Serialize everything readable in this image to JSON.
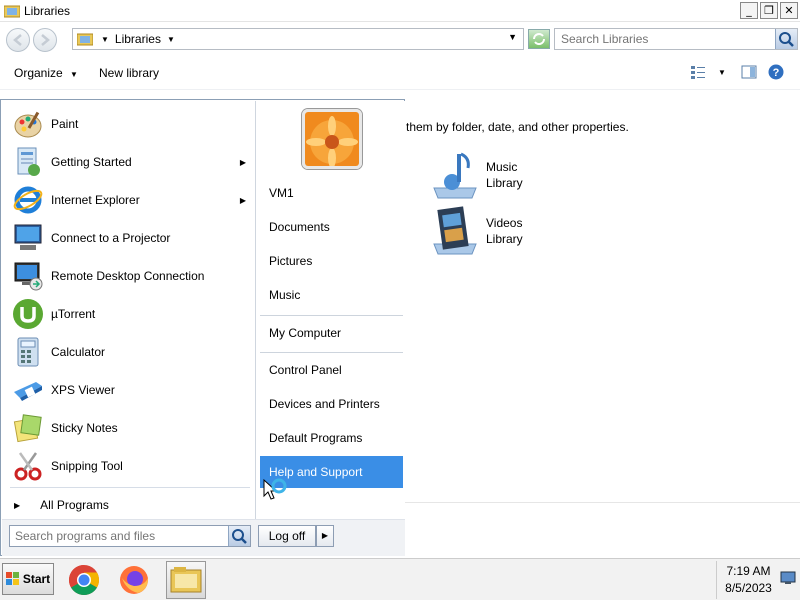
{
  "window": {
    "title": "Libraries",
    "minimize_glyph": "_",
    "maximize_glyph": "❐",
    "close_glyph": "✕"
  },
  "address_bar": {
    "crumb_label": "Libraries",
    "crumb_arrow": "▼",
    "dropdown_arrow": "▼",
    "search_placeholder": "Search Libraries"
  },
  "command_bar": {
    "organize_label": "Organize",
    "organize_arrow": "▼",
    "new_library_label": "New library",
    "view_arrow": "▼"
  },
  "content": {
    "description": "them by folder, date, and other properties.",
    "libraries": [
      {
        "name": "Music",
        "sub": "Library",
        "icon": "music-note-icon"
      },
      {
        "name": "Videos",
        "sub": "Library",
        "icon": "film-icon"
      }
    ]
  },
  "start_menu": {
    "programs": [
      {
        "label": "Paint",
        "icon": "paint-palette-icon",
        "has_submenu": false
      },
      {
        "label": "Getting Started",
        "icon": "getting-started-icon",
        "has_submenu": true
      },
      {
        "label": "Internet Explorer",
        "icon": "internet-explorer-icon",
        "has_submenu": true
      },
      {
        "label": "Connect to a Projector",
        "icon": "projector-icon",
        "has_submenu": false
      },
      {
        "label": "Remote Desktop Connection",
        "icon": "remote-desktop-icon",
        "has_submenu": false
      },
      {
        "label": "µTorrent",
        "icon": "utorrent-icon",
        "has_submenu": false
      },
      {
        "label": "Calculator",
        "icon": "calculator-icon",
        "has_submenu": false
      },
      {
        "label": "XPS Viewer",
        "icon": "xps-viewer-icon",
        "has_submenu": false
      },
      {
        "label": "Sticky Notes",
        "icon": "sticky-notes-icon",
        "has_submenu": false
      },
      {
        "label": "Snipping Tool",
        "icon": "scissors-icon",
        "has_submenu": false
      }
    ],
    "submenu_arrow": "▶",
    "all_programs_arrow": "▶",
    "all_programs_label": "All Programs",
    "right_items": {
      "user": "VM1",
      "documents": "Documents",
      "pictures": "Pictures",
      "music": "Music",
      "my_computer": "My Computer",
      "control_panel": "Control Panel",
      "devices_printers": "Devices and Printers",
      "default_programs": "Default Programs",
      "help_support": "Help and Support"
    },
    "search_placeholder": "Search programs and files",
    "log_off_label": "Log off",
    "log_off_arrow": "▶"
  },
  "taskbar": {
    "start_label": "Start",
    "time": "7:19 AM",
    "date": "8/5/2023",
    "pinned": [
      "chrome-icon",
      "firefox-icon",
      "explorer-folder-icon"
    ]
  },
  "colors": {
    "selection_blue": "#3a8ee6",
    "window_border": "#8b9fb5"
  }
}
